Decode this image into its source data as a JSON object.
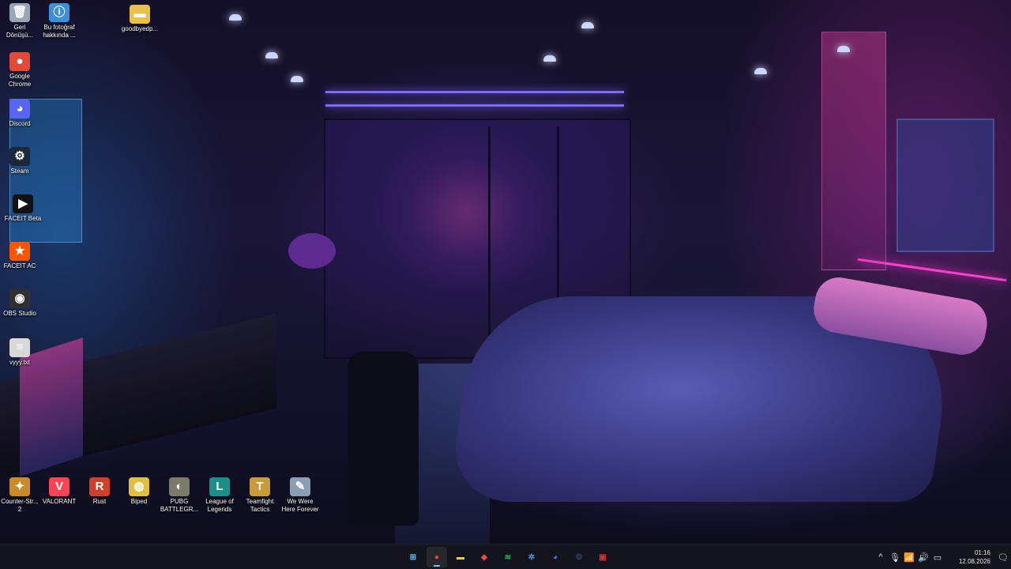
{
  "desktop": {
    "icons": [
      {
        "id": "recycle-bin",
        "label": "Geri Dönüşü...",
        "glyph": "🗑",
        "bg": "#9aa6b8"
      },
      {
        "id": "bu-fotograf",
        "label": "Bu fotoğraf hakkında ...",
        "glyph": "ⓘ",
        "bg": "#3c8fd8"
      },
      {
        "id": "goodbyedp-folder",
        "label": "goodbyedp...",
        "glyph": "▬",
        "bg": "#e8c04a"
      },
      {
        "id": "google-chrome",
        "label": "Google Chrome",
        "glyph": "●",
        "bg": "#e04a3a"
      },
      {
        "id": "discord",
        "label": "Discord",
        "glyph": "◕",
        "bg": "#5865f2"
      },
      {
        "id": "steam",
        "label": "Steam",
        "glyph": "⚙",
        "bg": "#1b2838"
      },
      {
        "id": "faceit",
        "label": "FACEIT Beta",
        "glyph": "▶",
        "bg": "#111111"
      },
      {
        "id": "faceit-ac",
        "label": "FACEIT AC",
        "glyph": "★",
        "bg": "#ff5500"
      },
      {
        "id": "obs-studio",
        "label": "OBS Studio",
        "glyph": "◉",
        "bg": "#303030"
      },
      {
        "id": "vyyy-txt",
        "label": "vyyy.txt",
        "glyph": "≡",
        "bg": "#d8d8d8"
      },
      {
        "id": "counter-strike",
        "label": "Counter-Str... 2",
        "glyph": "✦",
        "bg": "#c98a2a"
      },
      {
        "id": "valorant",
        "label": "VALORANT",
        "glyph": "V",
        "bg": "#fa4454"
      },
      {
        "id": "rust",
        "label": "Rust",
        "glyph": "R",
        "bg": "#cd412b"
      },
      {
        "id": "biped",
        "label": "Biped",
        "glyph": "◍",
        "bg": "#e0c040"
      },
      {
        "id": "pubg",
        "label": "PUBG BATTLEGR...",
        "glyph": "◐",
        "bg": "#7a7a6a"
      },
      {
        "id": "league-of-legends",
        "label": "League of Legends",
        "glyph": "L",
        "bg": "#1c8f8a"
      },
      {
        "id": "teamfight-tactics",
        "label": "Teamfight Tactics",
        "glyph": "T",
        "bg": "#c89b3c"
      },
      {
        "id": "we-were-here-forever",
        "label": "We Were Here Forever",
        "glyph": "✎",
        "bg": "#8aa0b0"
      }
    ]
  },
  "taskbar": {
    "apps": [
      {
        "id": "start",
        "glyph": "⊞",
        "color": "#4cc2ff",
        "active": false
      },
      {
        "id": "chrome",
        "glyph": "●",
        "color": "#e04a3a",
        "active": true
      },
      {
        "id": "file-explorer",
        "glyph": "▬",
        "color": "#f2c94c",
        "active": false
      },
      {
        "id": "app-red-diamond",
        "glyph": "◆",
        "color": "#f04a4a",
        "active": false
      },
      {
        "id": "spotify",
        "glyph": "≋",
        "color": "#1db954",
        "active": false
      },
      {
        "id": "app-settings-gear",
        "glyph": "✲",
        "color": "#3aa0e0",
        "active": false
      },
      {
        "id": "discord",
        "glyph": "◕",
        "color": "#5865f2",
        "active": false
      },
      {
        "id": "steam",
        "glyph": "⚙",
        "color": "#2a475e",
        "active": false
      },
      {
        "id": "app-red-square",
        "glyph": "▣",
        "color": "#d9303a",
        "active": false
      }
    ],
    "tray": {
      "chevron": "^",
      "mic": "🎙",
      "wifi": "📶",
      "volume": "🔊",
      "battery": "▭",
      "time": "01:16",
      "date": "12.08.2026",
      "notification": "🗨"
    }
  },
  "colors": {
    "taskbar_bg": "#14141c",
    "accent": "#7dc4ff"
  }
}
